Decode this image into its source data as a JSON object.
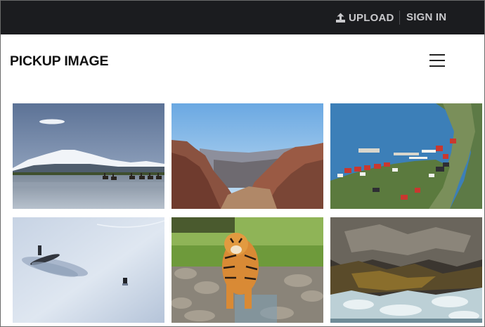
{
  "header": {
    "upload_label": "UPLOAD",
    "upload_icon": "upload-icon",
    "signin_label": "SIGN IN"
  },
  "brand": {
    "title": "PICKUP IMAGE"
  },
  "menu": {
    "icon": "hamburger-menu-icon"
  },
  "gallery": {
    "images": [
      {
        "subject": "snow-capped volcano with horse riders on beach"
      },
      {
        "subject": "red rock canyon valley"
      },
      {
        "subject": "aerial view of coastal harbor town"
      },
      {
        "subject": "submarine surfaced on sea ice"
      },
      {
        "subject": "tiger walking through stream"
      },
      {
        "subject": "waves crashing on rocky shoreline"
      }
    ]
  },
  "colors": {
    "topbar": "#1b1c1f",
    "topbar_text": "#c9c9cc",
    "brand_text": "#111111"
  }
}
